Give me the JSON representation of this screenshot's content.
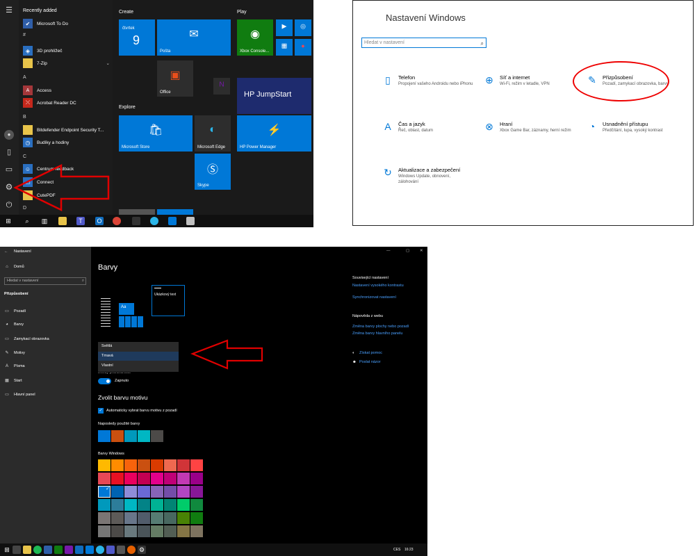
{
  "start_menu": {
    "recently_added": "Recently added",
    "items": [
      {
        "label": "Microsoft To Do",
        "icon": "todo-icon"
      },
      {
        "label": "3D prohlížeč",
        "icon": "cube-icon"
      },
      {
        "label": "7-Zip",
        "icon": "folder-icon"
      },
      {
        "label": "Access",
        "icon": "access-icon"
      },
      {
        "label": "Acrobat Reader DC",
        "icon": "acrobat-icon"
      },
      {
        "label": "Bitdefender Endpoint Security T...",
        "icon": "folder-icon"
      },
      {
        "label": "Budíky a hodiny",
        "icon": "clock-icon"
      },
      {
        "label": "Centrum feedback",
        "icon": "feedback-icon"
      },
      {
        "label": "Connect",
        "icon": "connect-icon"
      },
      {
        "label": "CutePDF",
        "icon": "folder-icon"
      }
    ],
    "groups": {
      "hash": "#",
      "a": "A",
      "b": "B",
      "c": "C",
      "d": "D"
    },
    "sections": {
      "create": "Create",
      "play": "Play",
      "explore": "Explore"
    },
    "tiles": {
      "calendar_day": "čtvrtek",
      "calendar_date": "9",
      "mail": "Pošta",
      "xbox": "Xbox Console...",
      "office": "Office",
      "hp_jumpstart": "HP JumpStart",
      "store": "Microsoft Store",
      "edge": "Microsoft Edge",
      "hp_power": "HP Power Manager",
      "skype": "Skype"
    }
  },
  "settings_home": {
    "title": "Nastavení Windows",
    "search_placeholder": "Hledat v nastavení",
    "categories": [
      {
        "title": "Telefon",
        "desc": "Propojení vašeho Androidu nebo iPhonu",
        "icon": "phone-icon"
      },
      {
        "title": "Síť a internet",
        "desc": "Wi-Fi, režim v letadle, VPN",
        "icon": "globe-icon"
      },
      {
        "title": "Přizpůsobení",
        "desc": "Pozadí, zamykací obrazovka, barvy",
        "icon": "personalization-icon"
      },
      {
        "title": "Čas a jazyk",
        "desc": "Řeč, oblast, datum",
        "icon": "time-language-icon"
      },
      {
        "title": "Hraní",
        "desc": "Xbox Game Bar, záznamy, herní režim",
        "icon": "xbox-icon"
      },
      {
        "title": "Usnadnění přístupu",
        "desc": "Předčítání, lupa, vysoký kontrast",
        "icon": "accessibility-icon"
      },
      {
        "title": "Aktualizace a zabezpečení",
        "desc": "Windows Update, obnovení, zálohování",
        "icon": "update-icon"
      }
    ]
  },
  "colors_settings": {
    "window_title": "Nastavení",
    "home": "Domů",
    "search_placeholder": "Hledat v nastavení",
    "section": "Přizpůsobení",
    "nav": [
      {
        "label": "Pozadí",
        "icon": "image-icon"
      },
      {
        "label": "Barvy",
        "icon": "palette-icon"
      },
      {
        "label": "Zamykací obrazovka",
        "icon": "lock-screen-icon"
      },
      {
        "label": "Motivy",
        "icon": "brush-icon"
      },
      {
        "label": "Písma",
        "icon": "font-icon"
      },
      {
        "label": "Start",
        "icon": "start-icon"
      },
      {
        "label": "Hlavní panel",
        "icon": "taskbar-icon"
      }
    ],
    "page_title": "Barvy",
    "preview_sample": "Ukázkový text",
    "preview_aa": "Aa",
    "mode_options": [
      "Světlá",
      "Tmavá",
      "Vlastní"
    ],
    "transparency_label": "Efekty průhlednosti",
    "toggle_state": "Zapnuto",
    "choose_accent": "Zvolit barvu motivu",
    "auto_accent": "Automaticky vybrat barvu motivu z pozadí",
    "recent_colors_label": "Naposledy použité barvy",
    "recent_colors": [
      "#0078d7",
      "#ca5010",
      "#0099bc",
      "#00b7c3",
      "#4c4a48"
    ],
    "windows_colors_label": "Barvy Windows",
    "windows_colors": [
      [
        "#ffb900",
        "#ff8c00",
        "#f7630c",
        "#ca5010",
        "#da3b01",
        "#ef6950",
        "#d13438",
        "#ff4343"
      ],
      [
        "#e74856",
        "#e81123",
        "#ea005e",
        "#c30052",
        "#e3008c",
        "#bf0077",
        "#c239b3",
        "#9a0089"
      ],
      [
        "#0078d7",
        "#0063b1",
        "#8e8cd8",
        "#6b69d6",
        "#8764b8",
        "#744da9",
        "#b146c2",
        "#881798"
      ],
      [
        "#0099bc",
        "#2d7d9a",
        "#00b7c3",
        "#038387",
        "#00b294",
        "#018574",
        "#00cc6a",
        "#10893e"
      ],
      [
        "#7a7574",
        "#5d5a58",
        "#68768a",
        "#515c6b",
        "#567c73",
        "#486860",
        "#498205",
        "#107c10"
      ],
      [
        "#767676",
        "#4c4a48",
        "#69797e",
        "#4a5459",
        "#647c64",
        "#525e54",
        "#847545",
        "#7e735f"
      ]
    ],
    "related_title": "Související nastavení",
    "related_links": [
      "Nastavení vysokého kontrastu",
      "Synchronizovat nastavení"
    ],
    "help_title": "Nápověda z webu",
    "help_links": [
      "Změna barvy plochy nebo pozadí",
      "Změna barvy hlavního panelu"
    ],
    "get_help": "Získat pomoc",
    "feedback": "Poslat názor",
    "tray_lang": "CES",
    "tray_time": "16:23"
  },
  "colors": {
    "accent": "#0078d7",
    "annotation": "#e00000"
  }
}
